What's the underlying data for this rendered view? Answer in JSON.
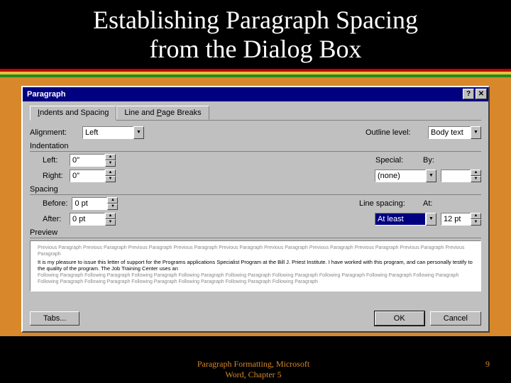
{
  "slide": {
    "title_line1": "Establishing Paragraph Spacing",
    "title_line2": "from the Dialog Box"
  },
  "dialog": {
    "title": "Paragraph",
    "help_btn": "?",
    "close_btn": "✕",
    "tabs": {
      "tab1_pre": "",
      "tab1_u": "I",
      "tab1_post": "ndents and Spacing",
      "tab2_pre": "Line and ",
      "tab2_u": "P",
      "tab2_post": "age Breaks"
    },
    "alignment": {
      "label": "Alignment:",
      "value": "Left"
    },
    "outline": {
      "label": "Outline level:",
      "value": "Body text"
    },
    "indentation": {
      "label": "Indentation"
    },
    "left": {
      "label": "Left:",
      "value": "0\""
    },
    "right": {
      "label": "Right:",
      "value": "0\""
    },
    "special": {
      "label": "Special:",
      "value": "(none)"
    },
    "by": {
      "label": "By:",
      "value": ""
    },
    "spacing": {
      "label": "Spacing"
    },
    "before": {
      "label": "Before:",
      "value": "0 pt"
    },
    "after": {
      "label": "After:",
      "value": "0 pt"
    },
    "line_spacing": {
      "label": "Line spacing:",
      "value": "At least"
    },
    "at": {
      "label": "At:",
      "value": "12 pt"
    },
    "preview": {
      "label": "Preview",
      "before_text": "Previous Paragraph Previous Paragraph Previous Paragraph Previous Paragraph Previous Paragraph Previous Paragraph Previous Paragraph Previous Paragraph Previous Paragraph Previous Paragraph",
      "sample_text": "It is my pleasure to issue this letter of support for the Programs applications Specialist Program at the Bill J. Priest Institute. I have worked with this program, and can personally testify to the quality of the program. The Job Training Center uses an",
      "after_text": "Following Paragraph Following Paragraph Following Paragraph Following Paragraph Following Paragraph Following Paragraph Following Paragraph Following Paragraph Following Paragraph Following Paragraph Following Paragraph Following Paragraph Following Paragraph Following Paragraph Following Paragraph"
    },
    "buttons": {
      "tabs": "Tabs...",
      "ok": "OK",
      "cancel": "Cancel"
    }
  },
  "footer": {
    "center_line1": "Paragraph Formatting, Microsoft",
    "center_line2": "Word, Chapter 5",
    "page": "9"
  },
  "glyphs": {
    "down": "▼",
    "up": "▲"
  }
}
